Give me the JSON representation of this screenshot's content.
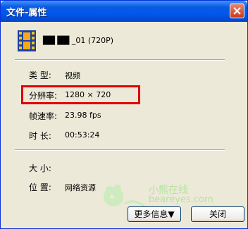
{
  "window": {
    "title": "文件-属性"
  },
  "file": {
    "name": "██ ██ _01 (720P)",
    "icon": "video-file-icon"
  },
  "properties": {
    "type": {
      "label": "类 型:",
      "value": "视频"
    },
    "resolution": {
      "label": "分辨率:",
      "value": "1280 × 720"
    },
    "frame_rate": {
      "label": "帧速率:",
      "value": "23.98 fps"
    },
    "duration": {
      "label": "时 长:",
      "value": "00:53:24"
    },
    "size": {
      "label": "大 小:",
      "value": ""
    },
    "location": {
      "label": "位 置:",
      "value": "网络资源"
    }
  },
  "watermark": {
    "text_cn": "小熊在线",
    "text_en": "beareyes.com"
  },
  "buttons": {
    "more_info": "更多信息▼",
    "close": "关闭"
  },
  "colors": {
    "highlight_box": "#E00000",
    "titlebar": "#0058EE",
    "window_bg": "#ECE9D8"
  }
}
